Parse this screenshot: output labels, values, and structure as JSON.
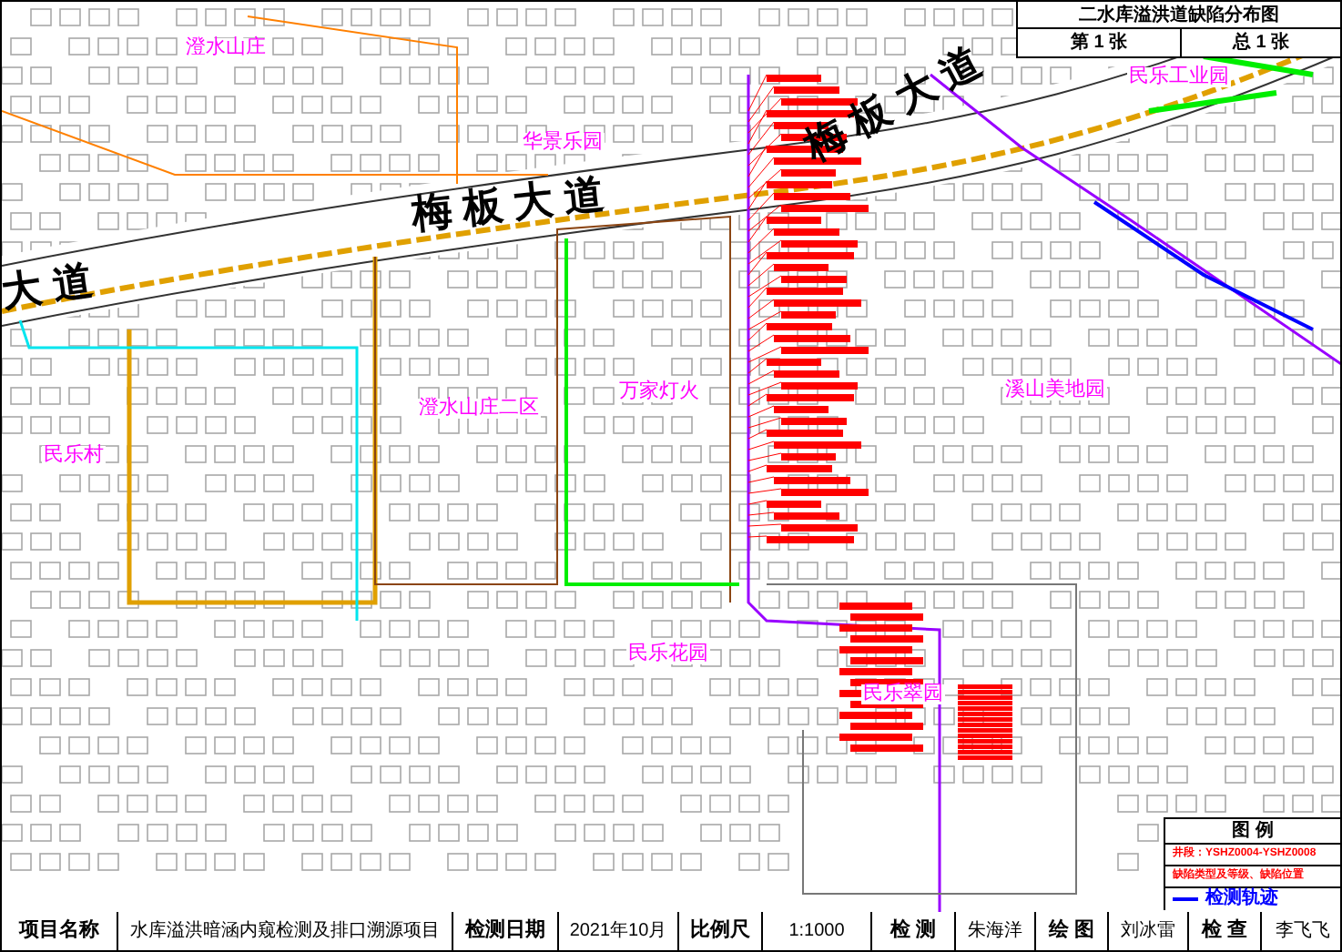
{
  "title_block": {
    "title": "二水库溢洪道缺陷分布图",
    "sheet": "第 1 张",
    "total": "总 1 张"
  },
  "map_labels": [
    {
      "text": "澄水山庄",
      "kind": "area"
    },
    {
      "text": "梅板大道",
      "kind": "road"
    },
    {
      "text": "民乐工业园",
      "kind": "area"
    },
    {
      "text": "华景乐园",
      "kind": "area"
    },
    {
      "text": "梅板大道",
      "kind": "road"
    },
    {
      "text": "大道",
      "kind": "road"
    },
    {
      "text": "澄水山庄二区",
      "kind": "area"
    },
    {
      "text": "万家灯火",
      "kind": "area"
    },
    {
      "text": "溪山美地园",
      "kind": "area"
    },
    {
      "text": "民乐村",
      "kind": "area"
    },
    {
      "text": "民乐花园",
      "kind": "area"
    },
    {
      "text": "民乐翠园",
      "kind": "area"
    }
  ],
  "legend": {
    "title": "图 例",
    "items": [
      {
        "kind": "text",
        "text": "井段：YSHZ0004-YSHZ0008",
        "color": "#ff0000"
      },
      {
        "kind": "text",
        "text": "缺陷类型及等级、缺陷位置",
        "color": "#ff0000"
      },
      {
        "kind": "line",
        "text": "检测轨迹",
        "color": "#0000ff"
      }
    ]
  },
  "footer": [
    {
      "kind": "label",
      "text": "项目名称"
    },
    {
      "kind": "value",
      "text": "水库溢洪暗涵内窥检测及排口溯源项目"
    },
    {
      "kind": "label",
      "text": "检测日期"
    },
    {
      "kind": "value",
      "text": "2021年10月"
    },
    {
      "kind": "label",
      "text": "比例尺"
    },
    {
      "kind": "value",
      "text": "1:1000"
    },
    {
      "kind": "label",
      "text": "检 测"
    },
    {
      "kind": "value",
      "text": "朱海洋"
    },
    {
      "kind": "label",
      "text": "绘 图"
    },
    {
      "kind": "value",
      "text": "刘冰雷"
    },
    {
      "kind": "label",
      "text": "检 查"
    },
    {
      "kind": "value",
      "text": "李飞飞"
    }
  ]
}
